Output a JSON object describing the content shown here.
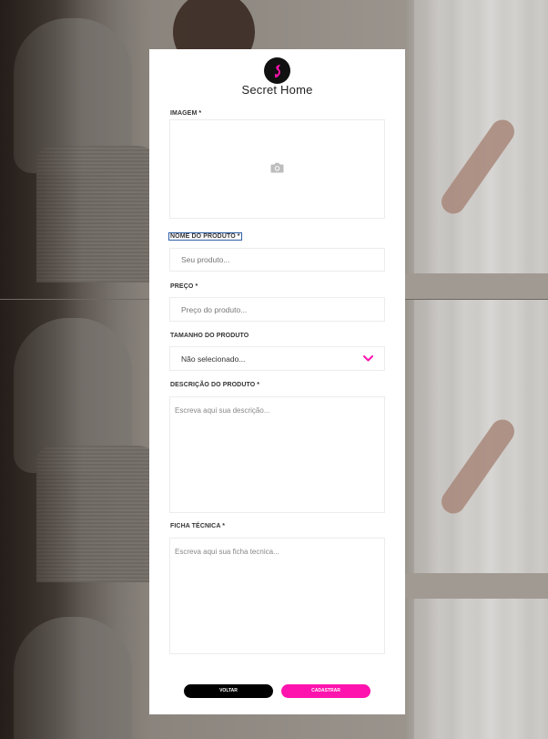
{
  "brand": {
    "name": "Secret Home",
    "logo_icon": "heel-icon",
    "accent_color": "#ff13ae"
  },
  "form": {
    "image": {
      "label": "IMAGEM *",
      "icon": "camera-icon"
    },
    "product_name": {
      "label": "NOME DO PRODUTO *",
      "placeholder": "Seu produto..."
    },
    "price": {
      "label": "PREÇO *",
      "placeholder": "Preço do produto..."
    },
    "size": {
      "label": "TAMANHO DO PRODUTO",
      "selected": "Não selecionado...",
      "icon": "chevron-down-icon"
    },
    "description": {
      "label": "DESCRIÇÃO DO PRODUTO *",
      "placeholder": "Escreva aqui sua descrição..."
    },
    "datasheet": {
      "label": "FICHA TÉCNICA *",
      "placeholder": "Escreva aqui sua ficha tecnica..."
    }
  },
  "actions": {
    "back_label": "VOLTAR",
    "submit_label": "CADASTRAR"
  }
}
